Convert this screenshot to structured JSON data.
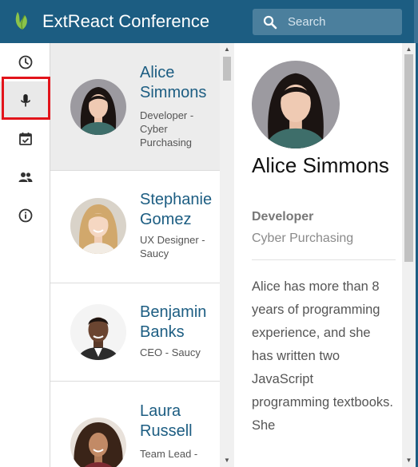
{
  "app": {
    "title": "ExtReact Conference"
  },
  "search": {
    "placeholder": "Search"
  },
  "nav": {
    "items": [
      {
        "icon": "clock-icon"
      },
      {
        "icon": "microphone-icon",
        "active": true
      },
      {
        "icon": "calendar-check-icon"
      },
      {
        "icon": "people-icon"
      },
      {
        "icon": "info-icon"
      }
    ]
  },
  "speakers": [
    {
      "name": "Alice Simmons",
      "role": "Developer - Cyber Purchasing",
      "selected": true
    },
    {
      "name": "Stephanie Gomez",
      "role": "UX Designer - Saucy"
    },
    {
      "name": "Benjamin Banks",
      "role": "CEO - Saucy"
    },
    {
      "name": "Laura Russell",
      "role": "Team Lead -"
    }
  ],
  "detail": {
    "name": "Alice Simmons",
    "title": "Developer",
    "company": "Cyber Purchasing",
    "bio": "Alice has more than 8 years of programming experience, and she has written two JavaScript programming textbooks. She"
  },
  "colors": {
    "brand": "#1c5d82",
    "highlight": "#e2141b",
    "link": "#1c5d82"
  }
}
